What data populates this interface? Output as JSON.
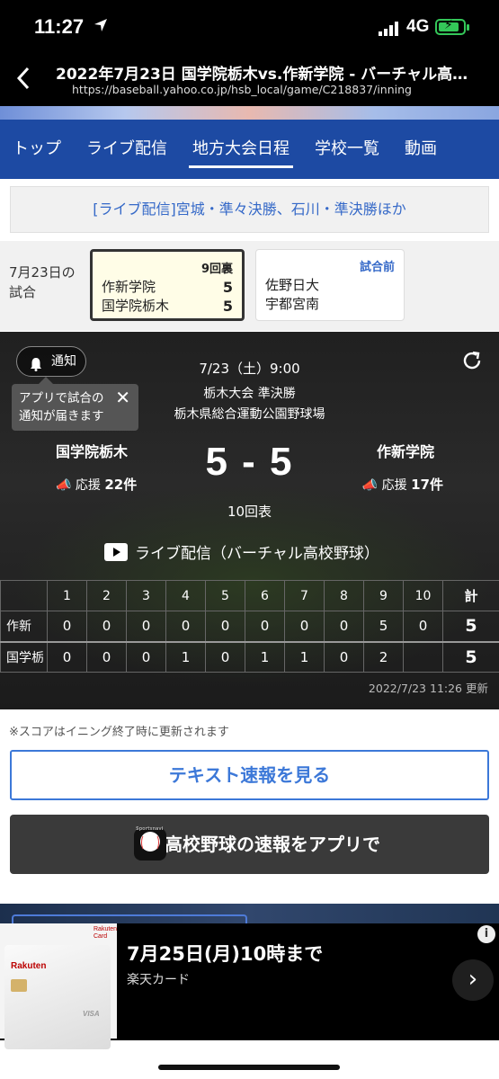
{
  "status_bar": {
    "time": "11:27",
    "network": "4G"
  },
  "browser": {
    "title": "2022年7月23日 国学院栃木vs.作新学院 - バーチャル高…",
    "url": "https://baseball.yahoo.co.jp/hsb_local/game/C218837/inning"
  },
  "nav": {
    "tabs": [
      "トップ",
      "ライブ配信",
      "地方大会日程",
      "学校一覧",
      "動画"
    ],
    "active": "地方大会日程"
  },
  "notice": "[ライブ配信]宮城・準々決勝、石川・準決勝ほか",
  "day_games": {
    "label_line1": "7月23日の",
    "label_line2": "試合",
    "games": [
      {
        "status": "9回裏",
        "team1": "作新学院",
        "score1": "5",
        "team2": "国学院栃木",
        "score2": "5"
      },
      {
        "status": "試合前",
        "team1": "佐野日大",
        "score1": "",
        "team2": "宇都宮南",
        "score2": ""
      }
    ]
  },
  "game": {
    "notify_label": "通知",
    "tooltip_line1": "アプリで試合の",
    "tooltip_line2": "通知が届きます",
    "datetime": "7/23（土）9:00",
    "tournament": "栃木大会 準決勝",
    "venue": "栃木県総合運動公園野球場",
    "home_team": "国学院栃木",
    "away_team": "作新学院",
    "score_text": "5 - 5",
    "inning": "10回表",
    "home_cheer_label": "応援",
    "home_cheer_count": "22件",
    "away_cheer_label": "応援",
    "away_cheer_count": "17件",
    "live_label": "ライブ配信（バーチャル高校野球）",
    "updated": "2022/7/23 11:26 更新"
  },
  "linescore": {
    "innings": [
      "1",
      "2",
      "3",
      "4",
      "5",
      "6",
      "7",
      "8",
      "9",
      "10"
    ],
    "total_header": "計",
    "rows": [
      {
        "team": "作新",
        "runs": [
          "0",
          "0",
          "0",
          "0",
          "0",
          "0",
          "0",
          "0",
          "5",
          "0"
        ],
        "total": "5"
      },
      {
        "team": "国学栃",
        "runs": [
          "0",
          "0",
          "0",
          "1",
          "0",
          "1",
          "1",
          "0",
          "2",
          ""
        ],
        "total": "5"
      }
    ]
  },
  "score_note": "※スコアはイニング終了時に更新されます",
  "text_button": "テキスト速報を見る",
  "app_button": "高校野球の速報をアプリで",
  "ad": {
    "headline": "7月25日(月)10時まで",
    "sponsor": "楽天カード",
    "card_brand": "Rakuten",
    "card_corner": "Rakuten Card",
    "card_network": "VISA"
  },
  "colors": {
    "nav_bg": "#1d4aa3",
    "link_blue": "#3569c8",
    "button_blue": "#3c78d8",
    "live_card_bg": "#fffde7"
  }
}
